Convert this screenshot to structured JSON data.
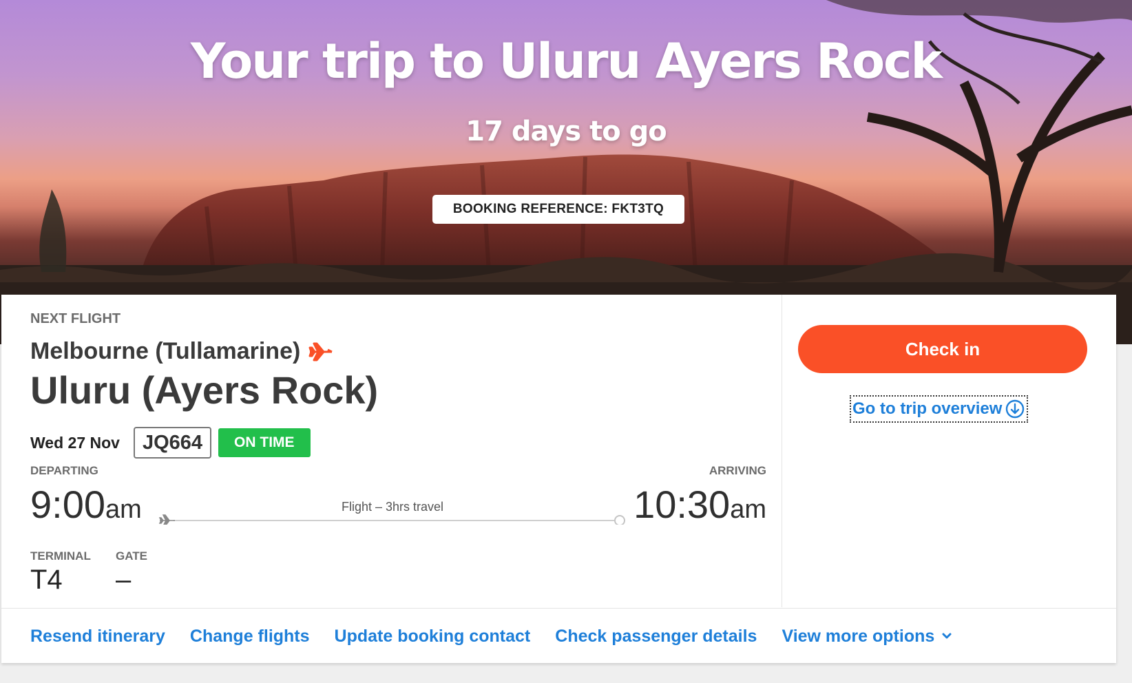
{
  "hero": {
    "title": "Your trip to Uluru Ayers Rock",
    "countdown": "17 days to go",
    "booking_reference": "BOOKING REFERENCE: FKT3TQ"
  },
  "flight": {
    "section_label": "NEXT FLIGHT",
    "origin": "Melbourne (Tullamarine)",
    "destination": "Uluru (Ayers Rock)",
    "date": "Wed 27 Nov",
    "flight_number": "JQ664",
    "status": "ON TIME",
    "departing_label": "DEPARTING",
    "arriving_label": "ARRIVING",
    "departure_time": "9:00",
    "departure_ampm": "am",
    "arrival_time": "10:30",
    "arrival_ampm": "am",
    "duration": "Flight – 3hrs travel",
    "terminal_label": "TERMINAL",
    "terminal": "T4",
    "gate_label": "GATE",
    "gate": "–"
  },
  "actions": {
    "check_in": "Check in",
    "trip_overview": "Go to trip overview",
    "links": [
      "Resend itinerary",
      "Change flights",
      "Update booking contact",
      "Check passenger details",
      "View more options"
    ]
  },
  "colors": {
    "accent_orange": "#fa5027",
    "link_blue": "#1e7fd9",
    "status_green": "#22bf4b"
  },
  "icons": {
    "plane": "plane-icon",
    "down_circle": "arrow-down-circle-icon",
    "chevron": "chevron-down-icon"
  }
}
